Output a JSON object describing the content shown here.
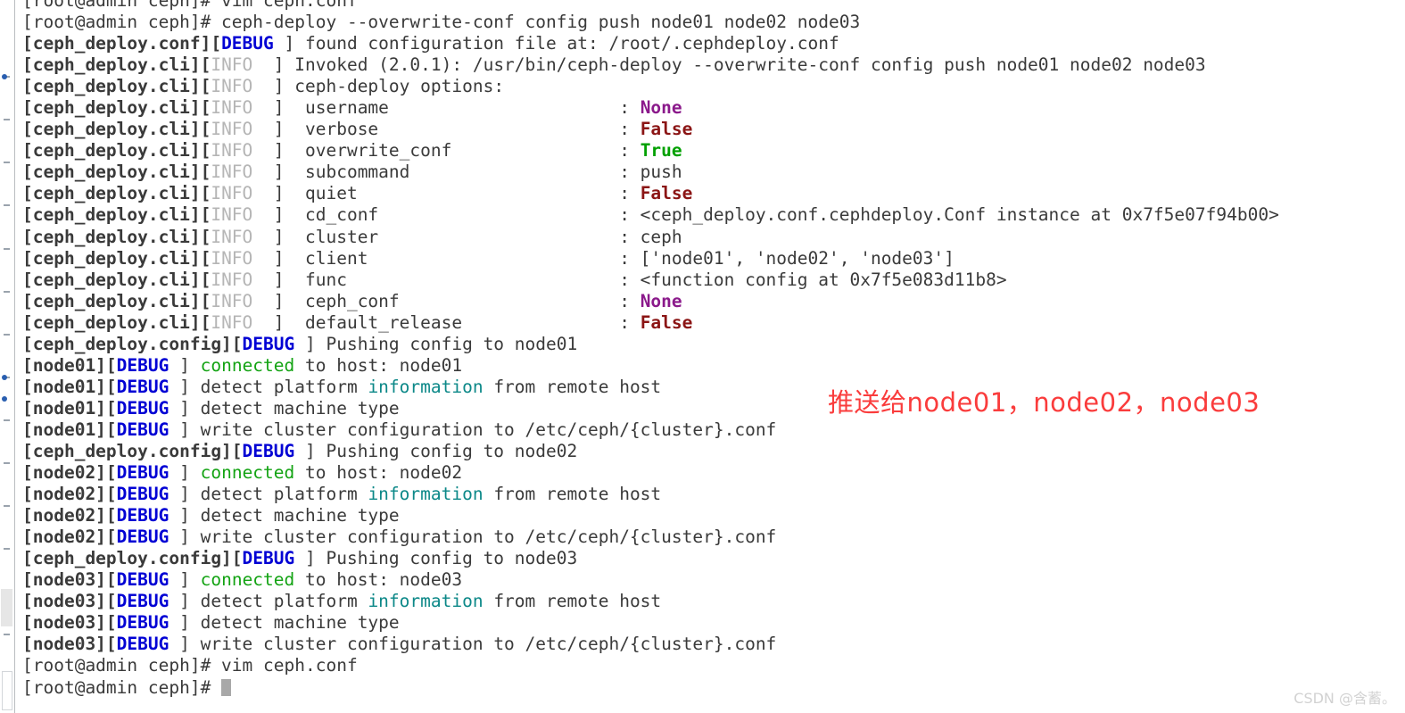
{
  "terminal": {
    "prompt": "[root@admin ceph]# ",
    "colors": {
      "background": "#ffffff",
      "text": "#3a3a3a",
      "debug": "#0000d4",
      "info": "#b5b5b5",
      "none_value": "#8b1a8b",
      "false_value": "#8b1515",
      "true_value": "#00a000",
      "connected": "#13a313",
      "information": "#0c8888",
      "annotation": "#fa3c3c",
      "watermark": "#d2d2d2"
    },
    "lines": [
      {
        "id": "l01",
        "segs": [
          {
            "t": "[root@admin ceph]# vim ceph.conf",
            "c": "plain"
          }
        ]
      },
      {
        "id": "l02",
        "segs": [
          {
            "t": "[root@admin ceph]# ceph-deploy --overwrite-conf config push node01 node02 node03",
            "c": "plain"
          }
        ]
      },
      {
        "id": "l03",
        "segs": [
          {
            "t": "[ceph_deploy.conf][",
            "c": "b"
          },
          {
            "t": "DEBUG",
            "c": "debug"
          },
          {
            "t": " ] found configuration file at: /root/.cephdeploy.conf",
            "c": "plain"
          }
        ]
      },
      {
        "id": "l04",
        "segs": [
          {
            "t": "[ceph_deploy.cli][",
            "c": "b"
          },
          {
            "t": "INFO",
            "c": "info"
          },
          {
            "t": "  ] Invoked (2.0.1): /usr/bin/ceph-deploy --overwrite-conf config push node01 node02 node03",
            "c": "plain"
          }
        ]
      },
      {
        "id": "l05",
        "segs": [
          {
            "t": "[ceph_deploy.cli][",
            "c": "b"
          },
          {
            "t": "INFO",
            "c": "info"
          },
          {
            "t": "  ] ceph-deploy options:",
            "c": "plain"
          }
        ]
      },
      {
        "id": "l06",
        "segs": [
          {
            "t": "[ceph_deploy.cli][",
            "c": "b"
          },
          {
            "t": "INFO",
            "c": "info"
          },
          {
            "t": "  ]  username                      : ",
            "c": "plain"
          },
          {
            "t": "None",
            "c": "none"
          }
        ]
      },
      {
        "id": "l07",
        "segs": [
          {
            "t": "[ceph_deploy.cli][",
            "c": "b"
          },
          {
            "t": "INFO",
            "c": "info"
          },
          {
            "t": "  ]  verbose                       : ",
            "c": "plain"
          },
          {
            "t": "False",
            "c": "false"
          }
        ]
      },
      {
        "id": "l08",
        "segs": [
          {
            "t": "[ceph_deploy.cli][",
            "c": "b"
          },
          {
            "t": "INFO",
            "c": "info"
          },
          {
            "t": "  ]  overwrite_conf                : ",
            "c": "plain"
          },
          {
            "t": "True",
            "c": "true"
          }
        ]
      },
      {
        "id": "l09",
        "segs": [
          {
            "t": "[ceph_deploy.cli][",
            "c": "b"
          },
          {
            "t": "INFO",
            "c": "info"
          },
          {
            "t": "  ]  subcommand                    : push",
            "c": "plain"
          }
        ]
      },
      {
        "id": "l10",
        "segs": [
          {
            "t": "[ceph_deploy.cli][",
            "c": "b"
          },
          {
            "t": "INFO",
            "c": "info"
          },
          {
            "t": "  ]  quiet                         : ",
            "c": "plain"
          },
          {
            "t": "False",
            "c": "false"
          }
        ]
      },
      {
        "id": "l11",
        "segs": [
          {
            "t": "[ceph_deploy.cli][",
            "c": "b"
          },
          {
            "t": "INFO",
            "c": "info"
          },
          {
            "t": "  ]  cd_conf                       : <ceph_deploy.conf.cephdeploy.Conf instance at 0x7f5e07f94b00>",
            "c": "plain"
          }
        ]
      },
      {
        "id": "l12",
        "segs": [
          {
            "t": "[ceph_deploy.cli][",
            "c": "b"
          },
          {
            "t": "INFO",
            "c": "info"
          },
          {
            "t": "  ]  cluster                       : ceph",
            "c": "plain"
          }
        ]
      },
      {
        "id": "l13",
        "segs": [
          {
            "t": "[ceph_deploy.cli][",
            "c": "b"
          },
          {
            "t": "INFO",
            "c": "info"
          },
          {
            "t": "  ]  client                        : ['node01', 'node02', 'node03']",
            "c": "plain"
          }
        ]
      },
      {
        "id": "l14",
        "segs": [
          {
            "t": "[ceph_deploy.cli][",
            "c": "b"
          },
          {
            "t": "INFO",
            "c": "info"
          },
          {
            "t": "  ]  func                          : <function config at 0x7f5e083d11b8>",
            "c": "plain"
          }
        ]
      },
      {
        "id": "l15",
        "segs": [
          {
            "t": "[ceph_deploy.cli][",
            "c": "b"
          },
          {
            "t": "INFO",
            "c": "info"
          },
          {
            "t": "  ]  ceph_conf                     : ",
            "c": "plain"
          },
          {
            "t": "None",
            "c": "none"
          }
        ]
      },
      {
        "id": "l16",
        "segs": [
          {
            "t": "[ceph_deploy.cli][",
            "c": "b"
          },
          {
            "t": "INFO",
            "c": "info"
          },
          {
            "t": "  ]  default_release               : ",
            "c": "plain"
          },
          {
            "t": "False",
            "c": "false"
          }
        ]
      },
      {
        "id": "l17",
        "segs": [
          {
            "t": "[ceph_deploy.config][",
            "c": "b"
          },
          {
            "t": "DEBUG",
            "c": "debug"
          },
          {
            "t": " ] Pushing config to node01",
            "c": "plain"
          }
        ]
      },
      {
        "id": "l18",
        "segs": [
          {
            "t": "[node01][",
            "c": "b"
          },
          {
            "t": "DEBUG",
            "c": "debug"
          },
          {
            "t": " ] ",
            "c": "plain"
          },
          {
            "t": "connected",
            "c": "connected"
          },
          {
            "t": " to host: node01",
            "c": "plain"
          }
        ]
      },
      {
        "id": "l19",
        "segs": [
          {
            "t": "[node01][",
            "c": "b"
          },
          {
            "t": "DEBUG",
            "c": "debug"
          },
          {
            "t": " ] detect platform ",
            "c": "plain"
          },
          {
            "t": "information",
            "c": "information"
          },
          {
            "t": " from remote host",
            "c": "plain"
          }
        ]
      },
      {
        "id": "l20",
        "segs": [
          {
            "t": "[node01][",
            "c": "b"
          },
          {
            "t": "DEBUG",
            "c": "debug"
          },
          {
            "t": " ] detect machine type",
            "c": "plain"
          }
        ]
      },
      {
        "id": "l21",
        "segs": [
          {
            "t": "[node01][",
            "c": "b"
          },
          {
            "t": "DEBUG",
            "c": "debug"
          },
          {
            "t": " ] write cluster configuration to /etc/ceph/{cluster}.conf",
            "c": "plain"
          }
        ]
      },
      {
        "id": "l22",
        "segs": [
          {
            "t": "[ceph_deploy.config][",
            "c": "b"
          },
          {
            "t": "DEBUG",
            "c": "debug"
          },
          {
            "t": " ] Pushing config to node02",
            "c": "plain"
          }
        ]
      },
      {
        "id": "l23",
        "segs": [
          {
            "t": "[node02][",
            "c": "b"
          },
          {
            "t": "DEBUG",
            "c": "debug"
          },
          {
            "t": " ] ",
            "c": "plain"
          },
          {
            "t": "connected",
            "c": "connected"
          },
          {
            "t": " to host: node02",
            "c": "plain"
          }
        ]
      },
      {
        "id": "l24",
        "segs": [
          {
            "t": "[node02][",
            "c": "b"
          },
          {
            "t": "DEBUG",
            "c": "debug"
          },
          {
            "t": " ] detect platform ",
            "c": "plain"
          },
          {
            "t": "information",
            "c": "information"
          },
          {
            "t": " from remote host",
            "c": "plain"
          }
        ]
      },
      {
        "id": "l25",
        "segs": [
          {
            "t": "[node02][",
            "c": "b"
          },
          {
            "t": "DEBUG",
            "c": "debug"
          },
          {
            "t": " ] detect machine type",
            "c": "plain"
          }
        ]
      },
      {
        "id": "l26",
        "segs": [
          {
            "t": "[node02][",
            "c": "b"
          },
          {
            "t": "DEBUG",
            "c": "debug"
          },
          {
            "t": " ] write cluster configuration to /etc/ceph/{cluster}.conf",
            "c": "plain"
          }
        ]
      },
      {
        "id": "l27",
        "segs": [
          {
            "t": "[ceph_deploy.config][",
            "c": "b"
          },
          {
            "t": "DEBUG",
            "c": "debug"
          },
          {
            "t": " ] Pushing config to node03",
            "c": "plain"
          }
        ]
      },
      {
        "id": "l28",
        "segs": [
          {
            "t": "[node03][",
            "c": "b"
          },
          {
            "t": "DEBUG",
            "c": "debug"
          },
          {
            "t": " ] ",
            "c": "plain"
          },
          {
            "t": "connected",
            "c": "connected"
          },
          {
            "t": " to host: node03",
            "c": "plain"
          }
        ]
      },
      {
        "id": "l29",
        "segs": [
          {
            "t": "[node03][",
            "c": "b"
          },
          {
            "t": "DEBUG",
            "c": "debug"
          },
          {
            "t": " ] detect platform ",
            "c": "plain"
          },
          {
            "t": "information",
            "c": "information"
          },
          {
            "t": " from remote host",
            "c": "plain"
          }
        ]
      },
      {
        "id": "l30",
        "segs": [
          {
            "t": "[node03][",
            "c": "b"
          },
          {
            "t": "DEBUG",
            "c": "debug"
          },
          {
            "t": " ] detect machine type",
            "c": "plain"
          }
        ]
      },
      {
        "id": "l31",
        "segs": [
          {
            "t": "[node03][",
            "c": "b"
          },
          {
            "t": "DEBUG",
            "c": "debug"
          },
          {
            "t": " ] write cluster configuration to /etc/ceph/{cluster}.conf",
            "c": "plain"
          }
        ]
      },
      {
        "id": "l32",
        "segs": [
          {
            "t": "[root@admin ceph]# vim ceph.conf",
            "c": "plain"
          }
        ]
      },
      {
        "id": "l33",
        "segs": [
          {
            "t": "[root@admin ceph]# ",
            "c": "plain"
          }
        ],
        "cursor": true
      }
    ]
  },
  "annotation": {
    "text": "推送给node01，node02，node03"
  },
  "watermark": {
    "text": "CSDN @含蓄。"
  },
  "gutter": {
    "tick_rows": [
      3,
      5,
      7,
      9,
      11,
      13,
      15,
      17,
      19,
      21,
      23,
      25,
      27,
      29
    ],
    "dot_rows": [
      3,
      17,
      18
    ]
  }
}
